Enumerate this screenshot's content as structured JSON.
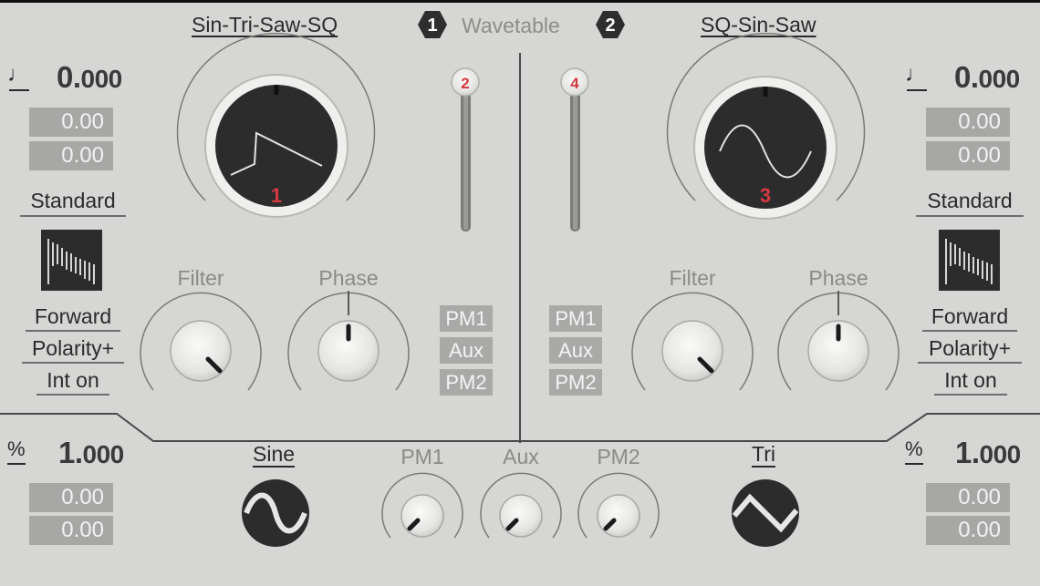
{
  "wavetable": {
    "label": "Wavetable",
    "badge_left": "1",
    "badge_right": "2"
  },
  "osc1": {
    "title": "Sin-Tri-Saw-SQ",
    "pitch_icon": "quarter-note-icon",
    "pitch_value_int": "0.",
    "pitch_value_dec": "000",
    "field_a": "0.00",
    "field_b": "0.00",
    "mode": "Standard",
    "direction": "Forward",
    "polarity": "Polarity+",
    "interp": "Int on",
    "main_knob_number": "1",
    "slider_number": "2",
    "filter_label": "Filter",
    "phase_label": "Phase",
    "mod_chips": [
      "PM1",
      "Aux",
      "PM2"
    ]
  },
  "osc2": {
    "title": "SQ-Sin-Saw",
    "pitch_icon": "quarter-note-icon",
    "pitch_value_int": "0.",
    "pitch_value_dec": "000",
    "field_a": "0.00",
    "field_b": "0.00",
    "mode": "Standard",
    "direction": "Forward",
    "polarity": "Polarity+",
    "interp": "Int on",
    "main_knob_number": "3",
    "slider_number": "4",
    "filter_label": "Filter",
    "phase_label": "Phase",
    "mod_chips": [
      "PM1",
      "Aux",
      "PM2"
    ]
  },
  "bottom": {
    "left": {
      "icon": "percent-icon",
      "value_int": "1.",
      "value_dec": "000",
      "field_a": "0.00",
      "field_b": "0.00"
    },
    "right": {
      "icon": "percent-icon",
      "value_int": "1.",
      "value_dec": "000",
      "field_a": "0.00",
      "field_b": "0.00"
    },
    "lfo1_label": "Sine",
    "lfo2_label": "Tri",
    "knobs": [
      "PM1",
      "Aux",
      "PM2"
    ]
  },
  "colors": {
    "background": "#d6d6d4",
    "accent_red": "#d43a40",
    "display_dark": "#2c2c2c",
    "value_box": "#a7a7a5"
  }
}
